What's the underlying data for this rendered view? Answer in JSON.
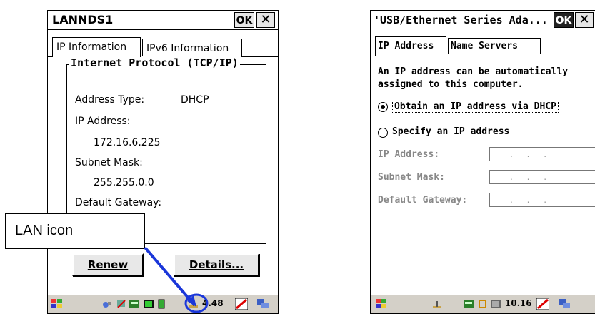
{
  "left": {
    "title": "LANNDS1",
    "ok": "OK",
    "close": "✕",
    "tabs": [
      "IP Information",
      "IPv6 Information"
    ],
    "group_title": "Internet Protocol (TCP/IP)",
    "address_type_label": "Address Type:",
    "address_type_value": "DHCP",
    "ip_label": "IP Address:",
    "ip_value": "172.16.6.225",
    "subnet_label": "Subnet Mask:",
    "subnet_value": "255.255.0.0",
    "gateway_label": "Default Gateway:",
    "renew_button": "Renew",
    "details_button": "Details...",
    "clock": "4.48"
  },
  "callout": {
    "text": "LAN icon",
    "color": "#1a36d9"
  },
  "right": {
    "title": "'USB/Ethernet Series Ada...",
    "ok": "OK",
    "close": "✕",
    "tabs": [
      "IP Address",
      "Name Servers"
    ],
    "intro_line1": "An IP address can be automatically",
    "intro_line2": "assigned to this computer.",
    "option_dhcp": "Obtain an IP address via DHCP",
    "option_specify": "Specify an IP address",
    "ip_label": "IP Address:",
    "subnet_label": "Subnet Mask:",
    "gateway_label": "Default Gateway:",
    "clock": "10.16"
  }
}
